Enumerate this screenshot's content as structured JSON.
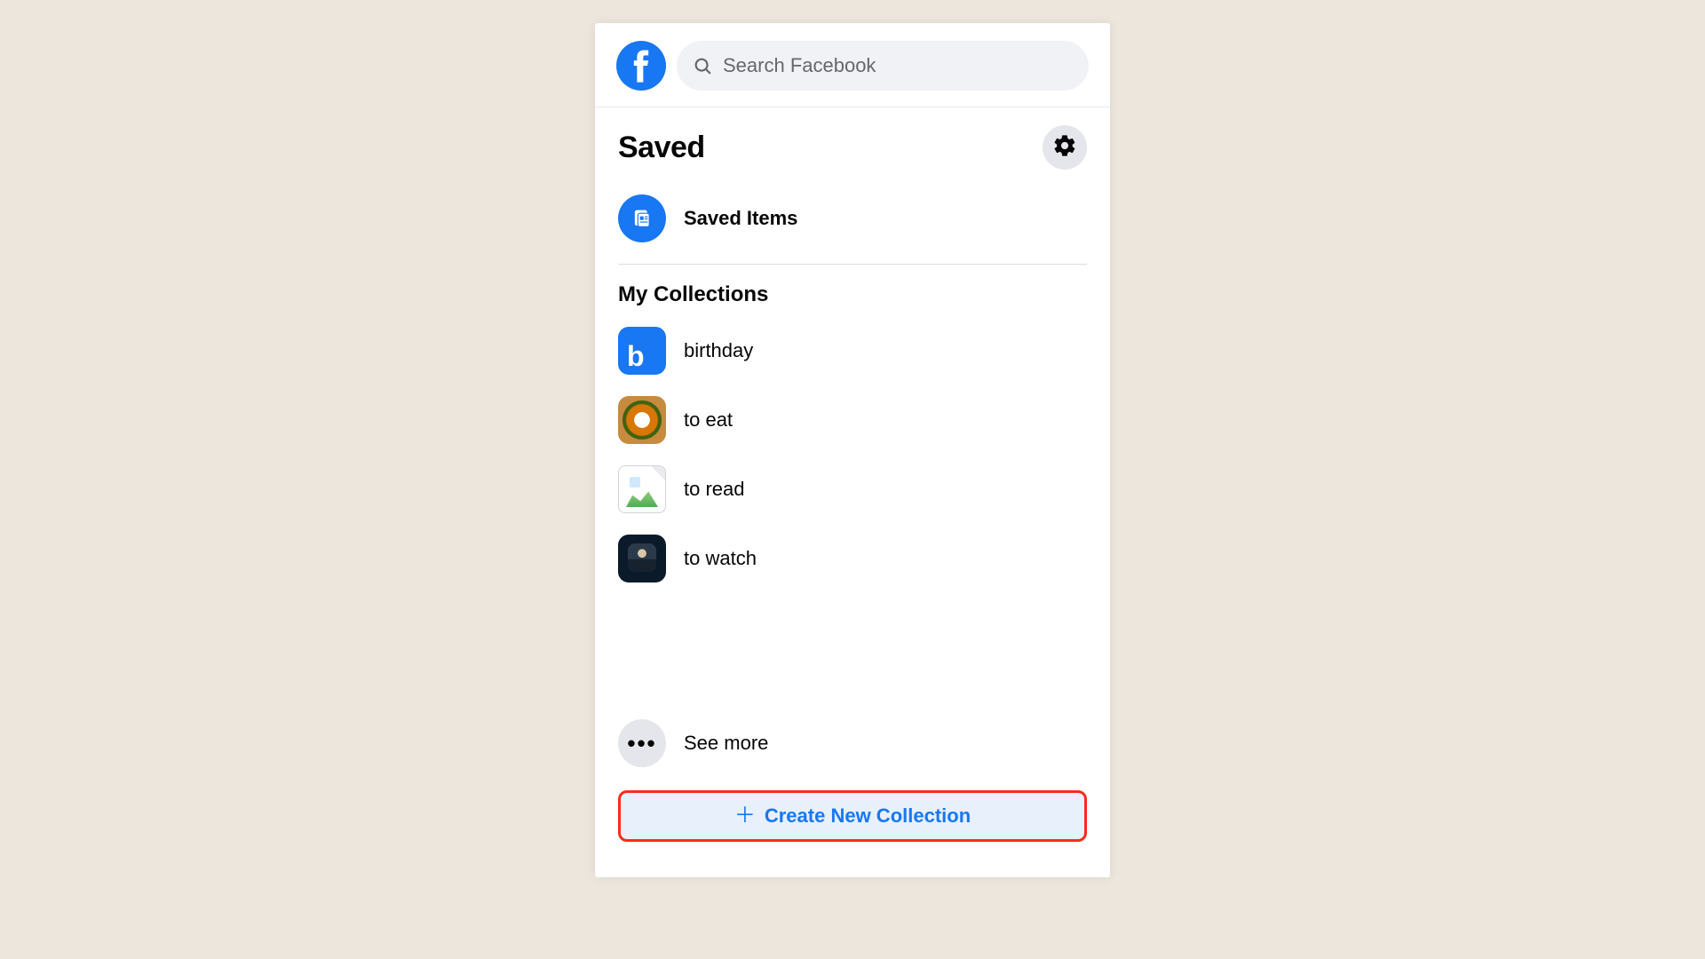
{
  "search": {
    "placeholder": "Search Facebook"
  },
  "page": {
    "title": "Saved"
  },
  "savedItems": {
    "label": "Saved Items"
  },
  "collections": {
    "title": "My Collections",
    "items": [
      {
        "label": "birthday"
      },
      {
        "label": "to eat"
      },
      {
        "label": "to read"
      },
      {
        "label": "to watch"
      }
    ]
  },
  "seeMore": {
    "label": "See more"
  },
  "createButton": {
    "label": "Create New Collection"
  },
  "colors": {
    "brand": "#1877f2",
    "highlight": "#ff2a1a",
    "background": "#ece6dd"
  }
}
